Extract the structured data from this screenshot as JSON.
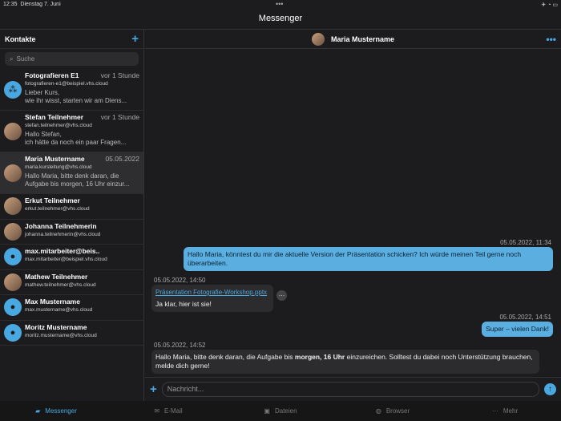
{
  "status": {
    "time": "12:35",
    "date": "Dienstag 7. Juni",
    "icons": "✈ ◔ ▭"
  },
  "app_title": "Messenger",
  "sidebar": {
    "title": "Kontakte",
    "search_placeholder": "Suche",
    "contacts": [
      {
        "name": "Fotografieren E1",
        "time": "vor 1 Stunde",
        "email": "fotografieren-e1@beispiel.vhs.cloud",
        "preview1": "Lieber Kurs,",
        "preview2": " wie ihr wisst, starten wir am Diens..."
      },
      {
        "name": "Stefan Teilnehmer",
        "time": "vor 1 Stunde",
        "email": "stefan.teilnehmer@vhs.cloud",
        "preview1": "Hallo Stefan,",
        "preview2": " ich hätte da noch ein paar Fragen..."
      },
      {
        "name": "Maria Mustername",
        "time": "05.05.2022",
        "email": "maria.kursleitung@vhs.cloud",
        "preview1": "Hallo Maria, bitte denk daran, die",
        "preview2": "Aufgabe bis morgen, 16 Uhr einzur..."
      },
      {
        "name": "Erkut Teilnehmer",
        "email": "erkut.teilnehmer@vhs.cloud"
      },
      {
        "name": "Johanna Teilnehmerin",
        "email": "johanna.teilnehmerin@vhs.cloud"
      },
      {
        "name": "max.mitarbeiter@beis..",
        "email": "max.mitarbeiter@beispiel.vhs.cloud"
      },
      {
        "name": "Mathew Teilnehmer",
        "email": "mathew.teilnehmer@vhs.cloud"
      },
      {
        "name": "Max Mustername",
        "email": "max.mustername@vhs.cloud"
      },
      {
        "name": "Moritz Mustername",
        "email": "moritz.mustername@vhs.cloud"
      }
    ]
  },
  "chat": {
    "contact": "Maria Mustername",
    "messages": [
      {
        "time": "05.05.2022, 11:34",
        "text": "Hallo Maria, könntest du mir die aktuelle Version der Präsentation schicken? Ich würde meinen Teil gerne noch überarbeiten."
      },
      {
        "time": "05.05.2022, 14:50",
        "attachment": "Präsentation Fotografie-Workshop.pptx",
        "text": "Ja klar, hier ist sie!"
      },
      {
        "time": "05.05.2022, 14:51",
        "text": "Super – vielen Dank!"
      },
      {
        "time": "05.05.2022, 14:52",
        "text_a": "Hallo Maria, bitte denk daran, die Aufgabe bis ",
        "text_bold": "morgen, 16 Uhr",
        "text_b": " einzureichen. Solltest du dabei noch Unterstützung brauchen, melde dich gerne!"
      }
    ],
    "input_placeholder": "Nachricht..."
  },
  "tabs": [
    {
      "label": "Messenger",
      "active": true
    },
    {
      "label": "E-Mail"
    },
    {
      "label": "Dateien"
    },
    {
      "label": "Browser"
    },
    {
      "label": "Mehr"
    }
  ],
  "colors": {
    "accent": "#4aa8e0",
    "outgoing": "#5aaee0",
    "incoming": "#2c2c2e"
  }
}
